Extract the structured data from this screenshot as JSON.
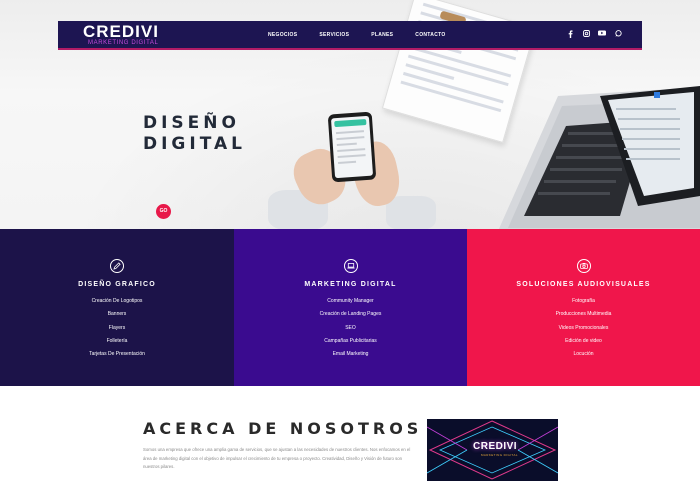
{
  "brand": {
    "logo": "CREDIVI",
    "tagline": "MARKETING DIGITAL"
  },
  "nav": {
    "links": [
      "NEGOCIOS",
      "SERVICIOS",
      "PLANES",
      "CONTACTO"
    ],
    "social_icons": [
      "facebook-icon",
      "instagram-icon",
      "youtube-icon",
      "whatsapp-icon"
    ]
  },
  "hero": {
    "title_line1": "DISEÑO",
    "title_line2": "DIGITAL",
    "button_label": "GO"
  },
  "services": [
    {
      "icon": "pen-icon",
      "title": "DISEÑO GRAFICO",
      "items": [
        "Creación De Logotipos",
        "Banners",
        "Flayers",
        "Folletería",
        "Tarjetas De Presentación"
      ]
    },
    {
      "icon": "laptop-icon",
      "title": "MARKETING DIGITAL",
      "items": [
        "Community Manager",
        "Creación de Landing Pages",
        "SEO",
        "Campañas Publicitarias",
        "Email Marketing"
      ]
    },
    {
      "icon": "camera-icon",
      "title": "SOLUCIONES AUDIOVISUALES",
      "items": [
        "Fotografía",
        "Producciones Multimedia",
        "Videos Promocionales",
        "Edición de video",
        "Locución"
      ]
    }
  ],
  "about": {
    "title": "ACERCA DE NOSOTROS",
    "text": "Somos una empresa que ofrece una amplia gama de servicios, que se ajustan a las necesidades de nuestros clientes. Nos enfocamos en el área de marketing digital con el objetivo de impulsar el crecimiento de tu empresa o proyecto. Creatividad, Diseño y Visión de futuro son nuestros pilares.",
    "image_logo": "CREDIVI",
    "image_tagline": "MARKETING DIGITAL"
  },
  "colors": {
    "nav_bg": "#1d1552",
    "col1_bg": "#1c1349",
    "col2_bg": "#3a0b8f",
    "col3_bg": "#f0164b",
    "accent": "#e8194a"
  }
}
